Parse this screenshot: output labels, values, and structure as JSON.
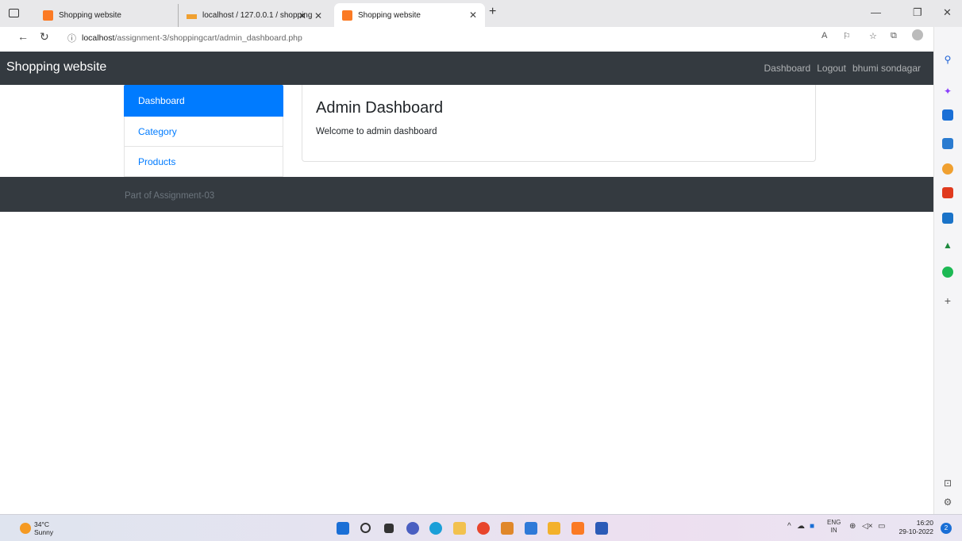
{
  "browser": {
    "tabs": [
      {
        "title": "Shopping website"
      },
      {
        "title": "localhost / 127.0.0.1 / shopping"
      },
      {
        "title": "Shopping website",
        "active": true
      }
    ],
    "url_host": "localhost",
    "url_path": "/assignment-3/shoppingcart/admin_dashboard.php",
    "info_icon": "ⓘ"
  },
  "site": {
    "brand": "Shopping website",
    "nav": {
      "dashboard": "Dashboard",
      "logout": "Logout",
      "user": "bhumi sondagar"
    },
    "sidebar": {
      "items": [
        {
          "label": "Dashboard",
          "active": true
        },
        {
          "label": "Category"
        },
        {
          "label": "Products"
        }
      ]
    },
    "card": {
      "title": "Admin Dashboard",
      "text": "Welcome to admin dashboard"
    },
    "footer": "Part of Assignment-03"
  },
  "taskbar": {
    "temperature": "34°C",
    "condition": "Sunny",
    "language": "ENG",
    "region": "IN",
    "time": "16:20",
    "date": "29-10-2022",
    "notification_count": "2"
  },
  "colors": {
    "navbar": "#343a40",
    "primary": "#007bff",
    "footer_text": "#6c757d"
  }
}
